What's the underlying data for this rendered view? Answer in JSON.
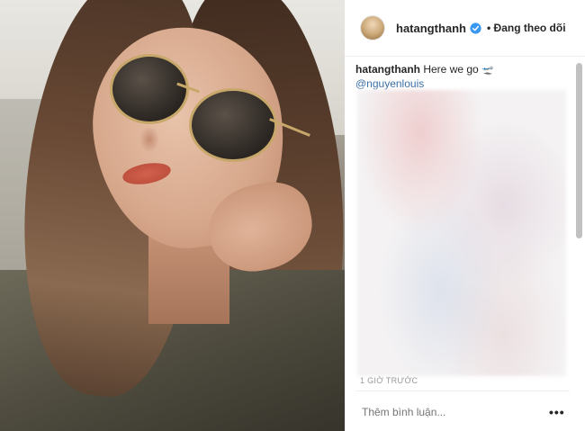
{
  "post": {
    "username": "hatangthanh",
    "follow_separator": "•",
    "follow_status": "Đang theo dõi",
    "caption_user": "hatangthanh",
    "caption_text": "Here we go",
    "caption_emoji": "🛫",
    "mention": "@nguyenlouis",
    "timestamp": "1 GIỜ TRƯỚC",
    "comment_placeholder": "Thêm bình luận...",
    "more_glyph": "•••"
  },
  "icons": {
    "verified": "verified-badge-icon",
    "more": "more-options-icon"
  },
  "colors": {
    "verified": "#3897f0",
    "mention": "#3b6ea5",
    "muted": "#999999",
    "text": "#262626"
  }
}
